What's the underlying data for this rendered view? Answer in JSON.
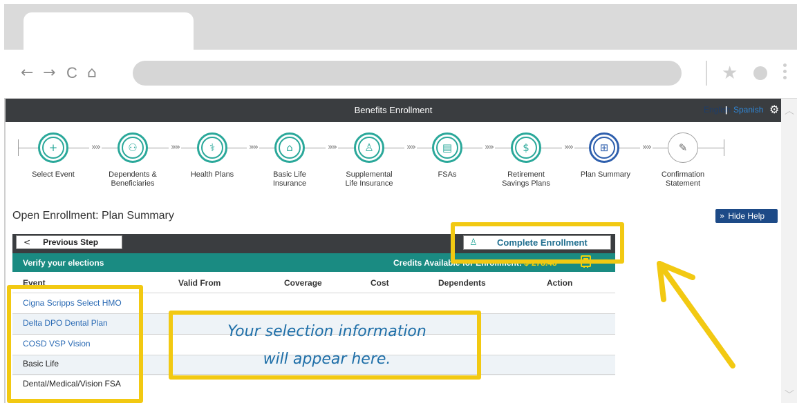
{
  "browser": {
    "nav": {
      "back": "←",
      "forward": "→",
      "reload": "C",
      "home": "⌂"
    }
  },
  "app": {
    "title": "Benefits Enrollment",
    "lang_english": "English",
    "lang_separator": "|",
    "lang_spanish": "Spanish"
  },
  "steps": [
    {
      "label": "Select Event",
      "icon": "plus-circle-icon",
      "glyph": "+",
      "state": "done"
    },
    {
      "label": "Dependents & Beneficiaries",
      "icon": "people-icon",
      "glyph": "👥",
      "state": "done"
    },
    {
      "label": "Health Plans",
      "icon": "stethoscope-icon",
      "glyph": "⚕",
      "state": "done"
    },
    {
      "label": "Basic Life Insurance",
      "icon": "family-house-icon",
      "glyph": "⌂",
      "state": "done"
    },
    {
      "label": "Supplemental Life Insurance",
      "icon": "add-person-icon",
      "glyph": "👤",
      "state": "done"
    },
    {
      "label": "FSAs",
      "icon": "wallet-icon",
      "glyph": "▤",
      "state": "done"
    },
    {
      "label": "Retirement Savings Plans",
      "icon": "money-bag-icon",
      "glyph": "$",
      "state": "done"
    },
    {
      "label": "Plan Summary",
      "icon": "chart-add-icon",
      "glyph": "⊞",
      "state": "current"
    },
    {
      "label": "Confirmation Statement",
      "icon": "signed-document-icon",
      "glyph": "✎",
      "state": "pending"
    }
  ],
  "step_labels": {
    "s0": [
      "Select Event"
    ],
    "s1": [
      "Dependents &",
      "Beneficiaries"
    ],
    "s2": [
      "Health Plans"
    ],
    "s3": [
      "Basic Life",
      "Insurance"
    ],
    "s4": [
      "Supplemental",
      "Life Insurance"
    ],
    "s5": [
      "FSAs"
    ],
    "s6": [
      "Retirement",
      "Savings Plans"
    ],
    "s7": [
      "Plan Summary"
    ],
    "s8": [
      "Confirmation",
      "Statement"
    ]
  },
  "page": {
    "title": "Open Enrollment: Plan Summary",
    "hide_help": "Hide Help"
  },
  "actions": {
    "previous_step": "Previous Step",
    "complete_enrollment": "Complete Enrollment"
  },
  "verify": {
    "title": "Verify your elections",
    "credits_label": "Credits Available for Enrollment:",
    "credits_amount": "$-278.48"
  },
  "table": {
    "columns": [
      "Event",
      "Valid From",
      "Coverage",
      "Cost",
      "Dependents",
      "Action"
    ],
    "rows": [
      {
        "event": "Cigna Scripps Select HMO",
        "link": true
      },
      {
        "event": "Delta DPO Dental Plan",
        "link": true
      },
      {
        "event": "COSD VSP Vision",
        "link": true
      },
      {
        "event": "Basic Life",
        "link": false
      },
      {
        "event": "Dental/Medical/Vision FSA",
        "link": false
      }
    ]
  },
  "help": {
    "line1": "Your selection information",
    "line2": "will appear here."
  },
  "colors": {
    "header": "#3a3d40",
    "teal": "#1a8b82",
    "highlight": "#f2c912",
    "link": "#2a6ab4",
    "help_button": "#1d4a87"
  }
}
